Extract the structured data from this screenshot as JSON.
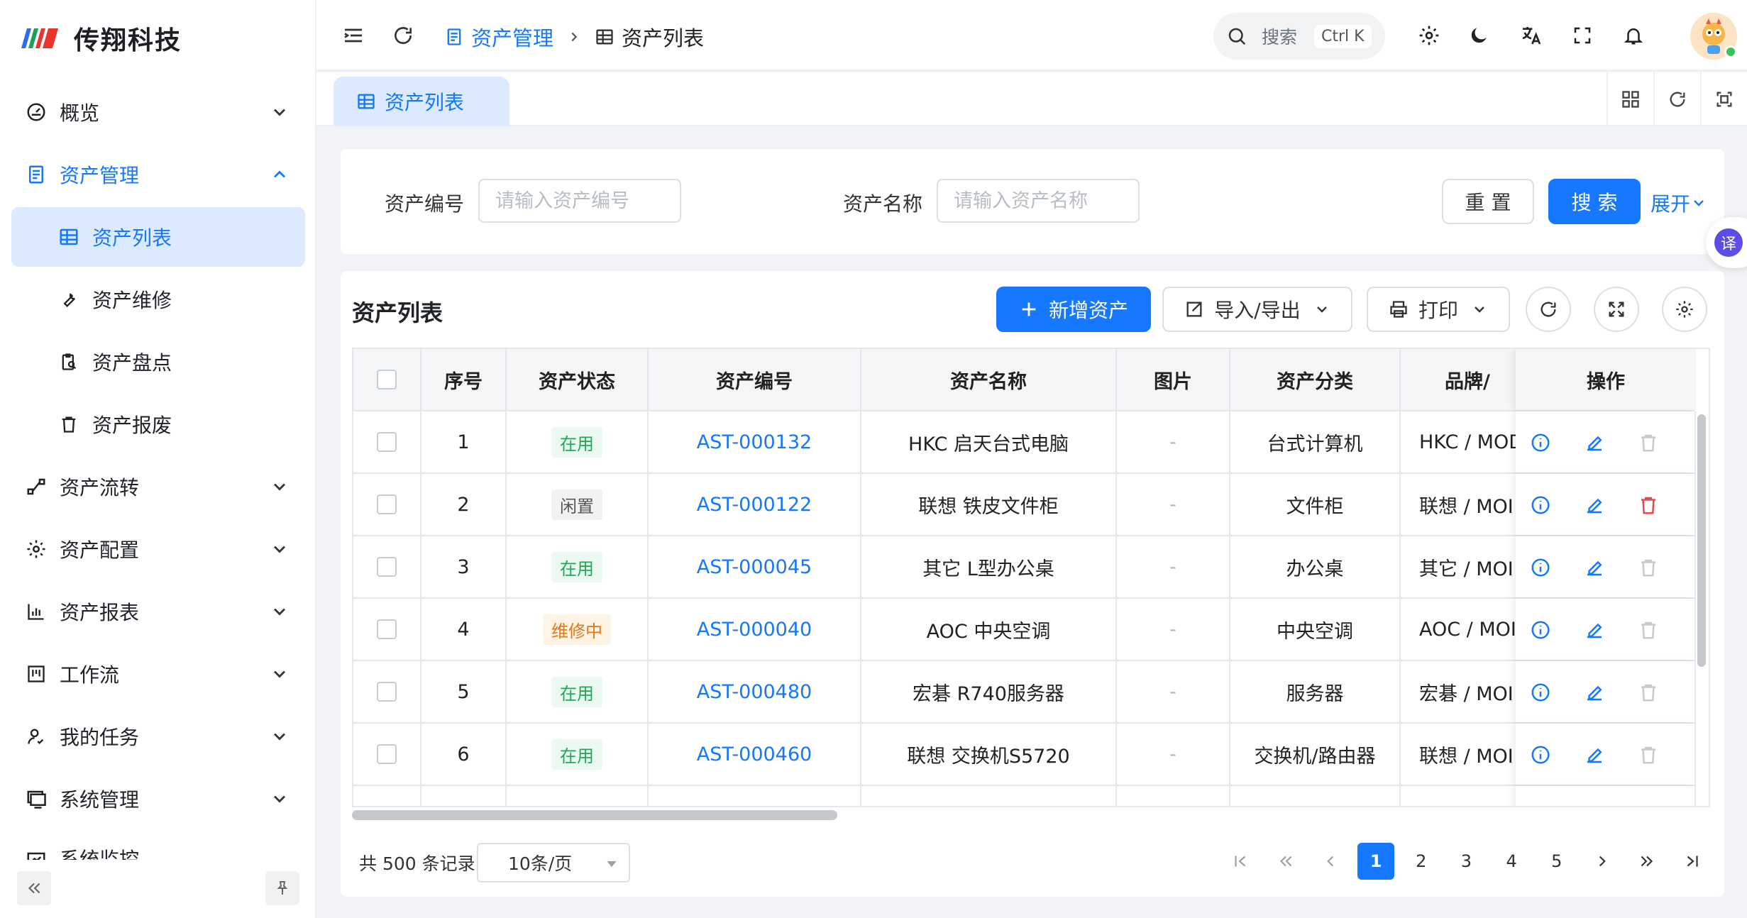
{
  "brand": {
    "name": "传翔科技"
  },
  "sidebar": {
    "items": [
      {
        "label": "概览",
        "icon": "dashboard-icon"
      },
      {
        "label": "资产管理",
        "icon": "document-icon"
      },
      {
        "label": "资产列表",
        "icon": "table-icon"
      },
      {
        "label": "资产维修",
        "icon": "wrench-icon"
      },
      {
        "label": "资产盘点",
        "icon": "clipboard-search-icon"
      },
      {
        "label": "资产报废",
        "icon": "trash-icon"
      },
      {
        "label": "资产流转",
        "icon": "flow-icon"
      },
      {
        "label": "资产配置",
        "icon": "gear-icon"
      },
      {
        "label": "资产报表",
        "icon": "bar-chart-icon"
      },
      {
        "label": "工作流",
        "icon": "kanban-icon"
      },
      {
        "label": "我的任务",
        "icon": "user-task-icon"
      },
      {
        "label": "系统管理",
        "icon": "monitor-icon"
      },
      {
        "label": "系统监控",
        "icon": "monitor-chart-icon"
      }
    ]
  },
  "header": {
    "breadcrumb": [
      "资产管理",
      "资产列表"
    ],
    "search_label": "搜索",
    "search_shortcut": "Ctrl K"
  },
  "tabs": [
    {
      "label": "资产列表"
    }
  ],
  "search_form": {
    "asset_no_label": "资产编号",
    "asset_no_placeholder": "请输入资产编号",
    "asset_name_label": "资产名称",
    "asset_name_placeholder": "请输入资产名称",
    "reset_label": "重 置",
    "search_label": "搜 索",
    "expand_label": "展开"
  },
  "translate_fab": "译",
  "table": {
    "title": "资产列表",
    "add_label": "新增资产",
    "import_export_label": "导入/导出",
    "print_label": "打印",
    "columns": [
      "序号",
      "资产状态",
      "资产编号",
      "资产名称",
      "图片",
      "资产分类",
      "品牌/",
      "操作"
    ],
    "rows": [
      {
        "idx": "1",
        "status": "在用",
        "status_color": "#23a55a",
        "no": "AST-000132",
        "name": "HKC 启天台式电脑",
        "image": "-",
        "category": "台式计算机",
        "brand": "HKC / MOD",
        "delete_enabled": false
      },
      {
        "idx": "2",
        "status": "闲置",
        "status_color": "#555555",
        "no": "AST-000122",
        "name": "联想 铁皮文件柜",
        "image": "-",
        "category": "文件柜",
        "brand": "联想 / MOI",
        "delete_enabled": true
      },
      {
        "idx": "3",
        "status": "在用",
        "status_color": "#23a55a",
        "no": "AST-000045",
        "name": "其它 L型办公桌",
        "image": "-",
        "category": "办公桌",
        "brand": "其它 / MOI",
        "delete_enabled": false
      },
      {
        "idx": "4",
        "status": "维修中",
        "status_color": "#e8760f",
        "no": "AST-000040",
        "name": "AOC 中央空调",
        "image": "-",
        "category": "中央空调",
        "brand": "AOC / MOI",
        "delete_enabled": false
      },
      {
        "idx": "5",
        "status": "在用",
        "status_color": "#23a55a",
        "no": "AST-000480",
        "name": "宏碁 R740服务器",
        "image": "-",
        "category": "服务器",
        "brand": "宏碁 / MOI",
        "delete_enabled": false
      },
      {
        "idx": "6",
        "status": "在用",
        "status_color": "#23a55a",
        "no": "AST-000460",
        "name": "联想 交换机S5720",
        "image": "-",
        "category": "交换机/路由器",
        "brand": "联想 / MOI",
        "delete_enabled": false
      }
    ]
  },
  "pagination": {
    "total_text": "共 500 条记录",
    "page_size": "10条/页",
    "pages": [
      "1",
      "2",
      "3",
      "4",
      "5"
    ],
    "current_page": 1
  },
  "colors": {
    "primary": "#1677ff",
    "danger": "#e5484d",
    "active_bg": "#dbeafe"
  }
}
